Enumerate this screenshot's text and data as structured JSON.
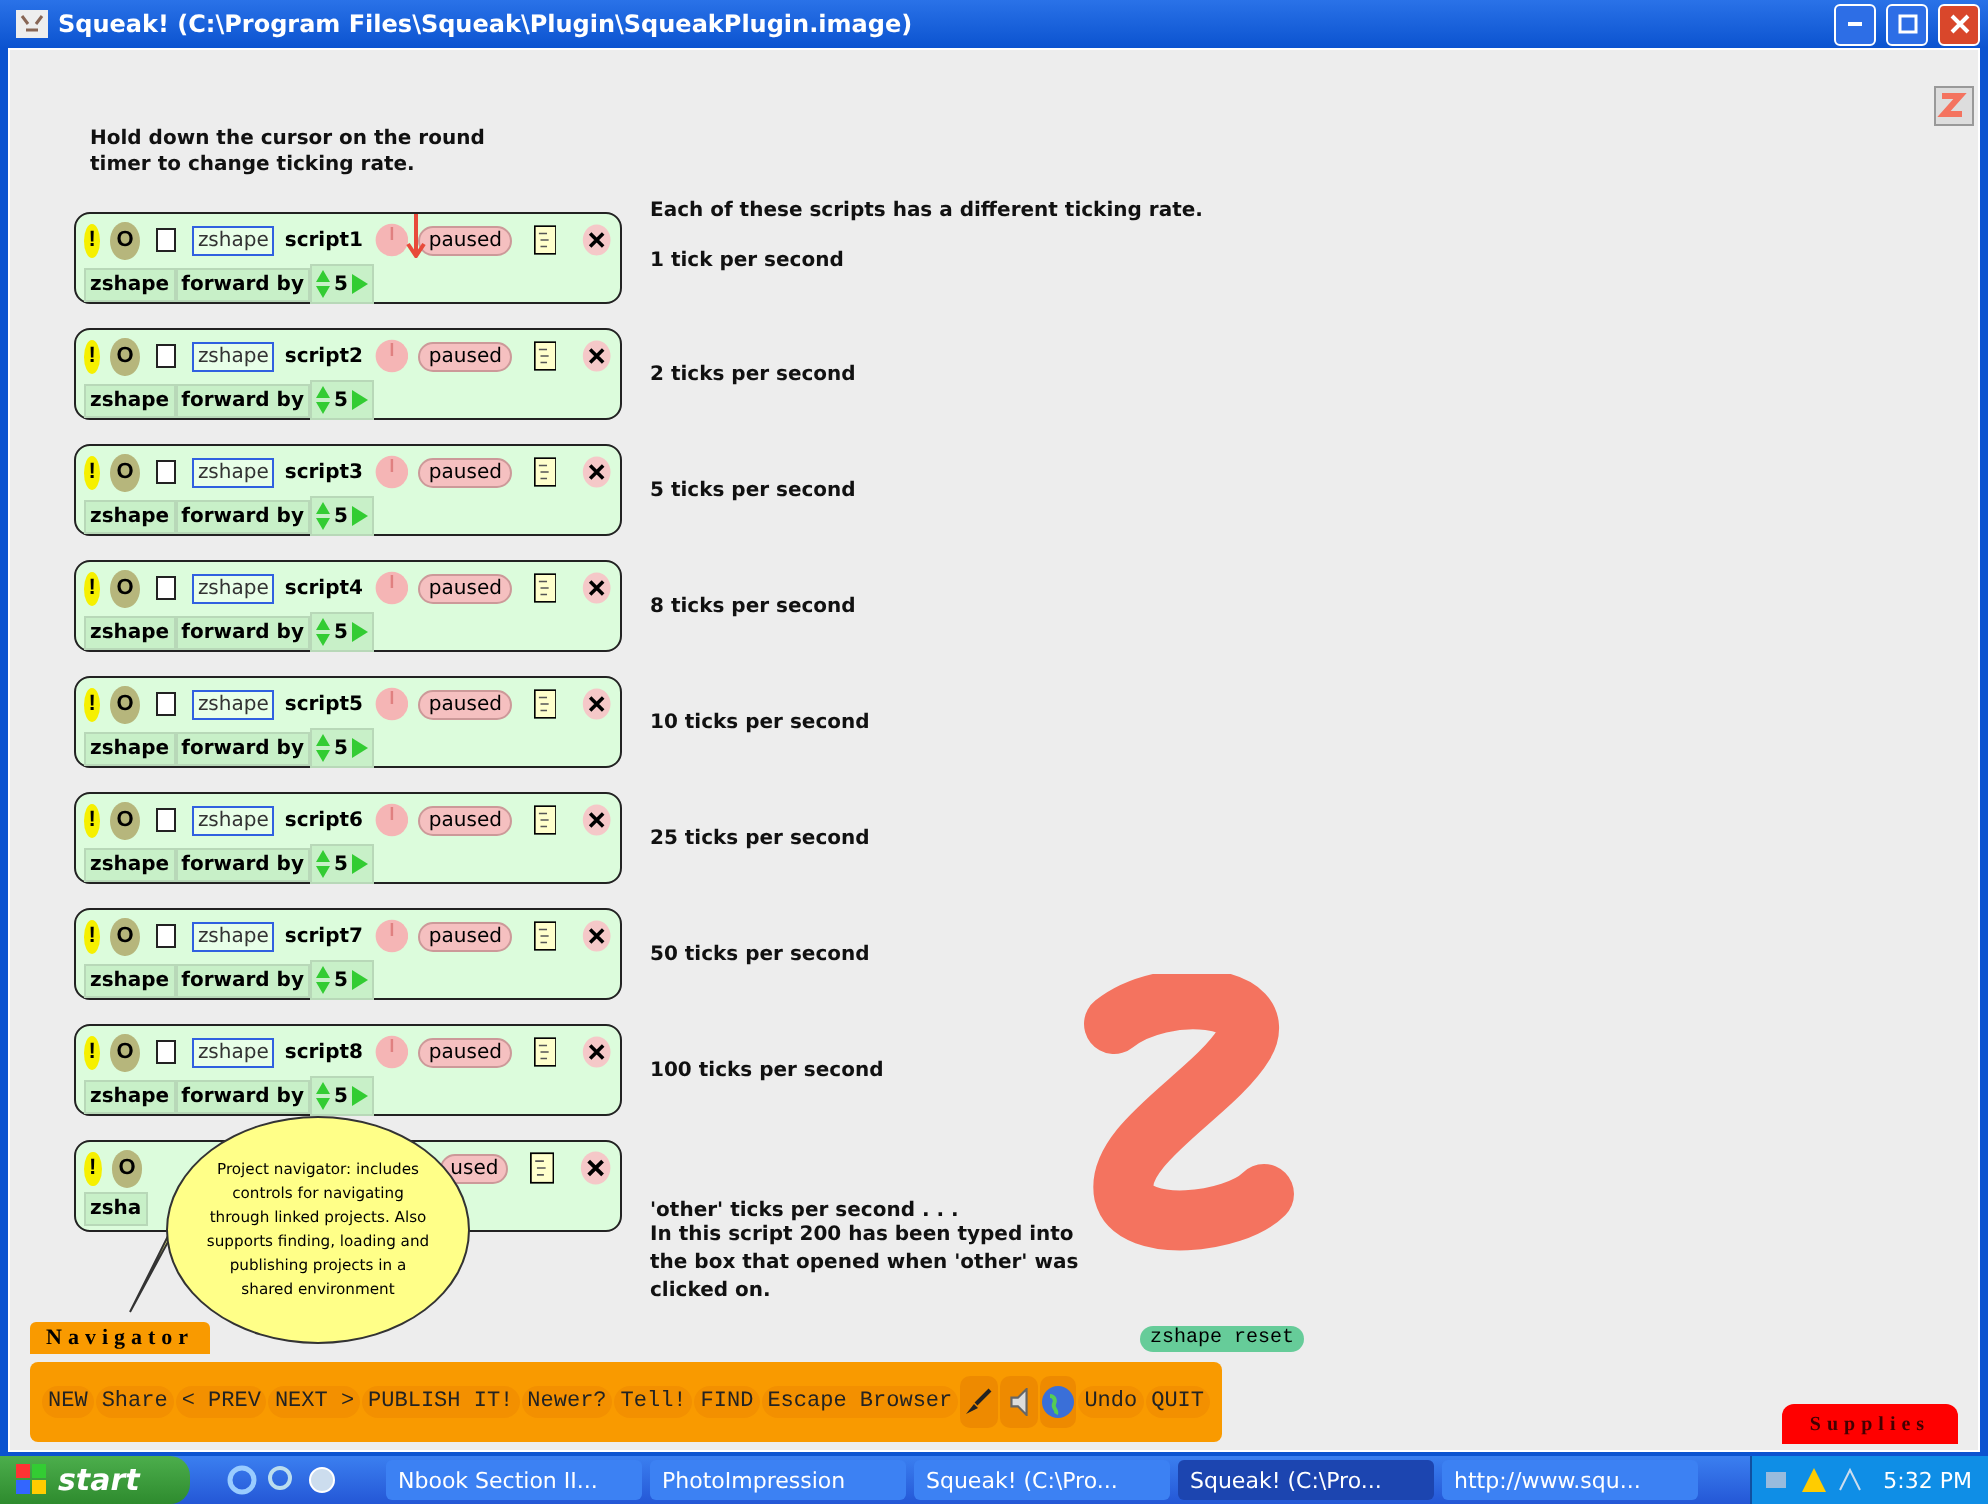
{
  "window": {
    "title": "Squeak! (C:\\Program Files\\Squeak\\Plugin\\SqueakPlugin.image)"
  },
  "instruction": "Hold down the cursor on the round timer to change ticking rate.",
  "heading": "Each of these scripts has a different ticking rate.",
  "scripts": [
    {
      "exclaim": "!",
      "go": "O",
      "checked": false,
      "player": "zshape",
      "name": "script1",
      "status": "paused",
      "command": {
        "player": "zshape",
        "verb": "forward by",
        "value": "5"
      },
      "rate": "1 tick per second"
    },
    {
      "exclaim": "!",
      "go": "O",
      "checked": false,
      "player": "zshape",
      "name": "script2",
      "status": "paused",
      "command": {
        "player": "zshape",
        "verb": "forward by",
        "value": "5"
      },
      "rate": "2 ticks per second"
    },
    {
      "exclaim": "!",
      "go": "O",
      "checked": false,
      "player": "zshape",
      "name": "script3",
      "status": "paused",
      "command": {
        "player": "zshape",
        "verb": "forward by",
        "value": "5"
      },
      "rate": "5 ticks per second"
    },
    {
      "exclaim": "!",
      "go": "O",
      "checked": false,
      "player": "zshape",
      "name": "script4",
      "status": "paused",
      "command": {
        "player": "zshape",
        "verb": "forward by",
        "value": "5"
      },
      "rate": "8 ticks per second"
    },
    {
      "exclaim": "!",
      "go": "O",
      "checked": false,
      "player": "zshape",
      "name": "script5",
      "status": "paused",
      "command": {
        "player": "zshape",
        "verb": "forward by",
        "value": "5"
      },
      "rate": "10 ticks per second"
    },
    {
      "exclaim": "!",
      "go": "O",
      "checked": false,
      "player": "zshape",
      "name": "script6",
      "status": "paused",
      "command": {
        "player": "zshape",
        "verb": "forward by",
        "value": "5"
      },
      "rate": "25 ticks per second"
    },
    {
      "exclaim": "!",
      "go": "O",
      "checked": false,
      "player": "zshape",
      "name": "script7",
      "status": "paused",
      "command": {
        "player": "zshape",
        "verb": "forward by",
        "value": "5"
      },
      "rate": "50 ticks per second"
    },
    {
      "exclaim": "!",
      "go": "O",
      "checked": false,
      "player": "zshape",
      "name": "script8",
      "status": "paused",
      "command": {
        "player": "zshape",
        "verb": "forward by",
        "value": "5"
      },
      "rate": "100 ticks per second"
    },
    {
      "exclaim": "!",
      "go": "O",
      "status": "used",
      "command": {
        "player": "zsha"
      },
      "rate": "'other' ticks per second . . .",
      "note": "In this script 200 has been typed into the box that opened when 'other' was clicked on."
    }
  ],
  "balloon": "Project navigator: includes controls for navigating through linked projects.  Also supports finding, loading and publishing projects in a shared environment",
  "reset_button": "zshape reset",
  "navigator": {
    "tab": "Navigator",
    "buttons": [
      {
        "kind": "text",
        "label": "NEW"
      },
      {
        "kind": "text",
        "label": "Share"
      },
      {
        "kind": "text",
        "label": "< PREV"
      },
      {
        "kind": "text",
        "label": "NEXT >"
      },
      {
        "kind": "text",
        "label": "PUBLISH IT!"
      },
      {
        "kind": "text",
        "label": "Newer?"
      },
      {
        "kind": "text",
        "label": "Tell!"
      },
      {
        "kind": "text",
        "label": "FIND"
      },
      {
        "kind": "text",
        "label": "Escape Browser"
      },
      {
        "kind": "paint"
      },
      {
        "kind": "sound"
      },
      {
        "kind": "globe"
      },
      {
        "kind": "text",
        "label": "Undo"
      },
      {
        "kind": "text",
        "label": "QUIT"
      }
    ]
  },
  "supplies_tab": "Supplies",
  "taskbar": {
    "start": "start",
    "items": [
      {
        "label": "Nbook Section II...",
        "selected": false
      },
      {
        "label": "PhotoImpression",
        "selected": false
      },
      {
        "label": "Squeak! (C:\\Pro...",
        "selected": false
      },
      {
        "label": "Squeak! (C:\\Pro...",
        "selected": true
      },
      {
        "label": "http://www.squ...",
        "selected": false
      }
    ],
    "clock": "5:32 PM"
  }
}
